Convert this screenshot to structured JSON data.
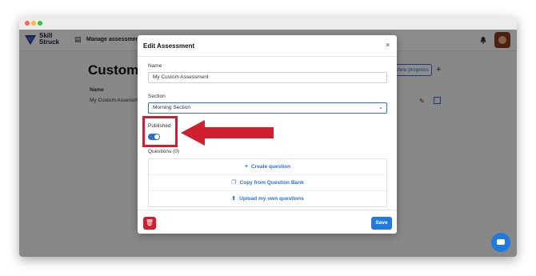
{
  "app": {
    "logo_text_line1": "Skill",
    "logo_text_line2": "Struck",
    "nav_label": "Manage assessments"
  },
  "page": {
    "title": "Custom A",
    "column_name": "Name",
    "row_name": "My Custom Assessme",
    "view_progress_label": "View progress",
    "add_label": "+"
  },
  "modal": {
    "title": "Edit Assessment",
    "close_label": "×",
    "name_label": "Name",
    "name_value": "My Custom Assessment",
    "section_label": "Section",
    "section_value": "Morning Section",
    "published_label": "Published",
    "published_on": true,
    "questions_label": "Questions (0)",
    "actions": [
      {
        "icon": "+",
        "label": "Create question"
      },
      {
        "icon": "❐",
        "label": "Copy from Question Bank"
      },
      {
        "icon": "⬆",
        "label": "Upload my own questions"
      }
    ],
    "save_label": "Save"
  },
  "colors": {
    "accent": "#2d6fd6",
    "danger": "#d11f2f",
    "save": "#1f7ae0"
  }
}
